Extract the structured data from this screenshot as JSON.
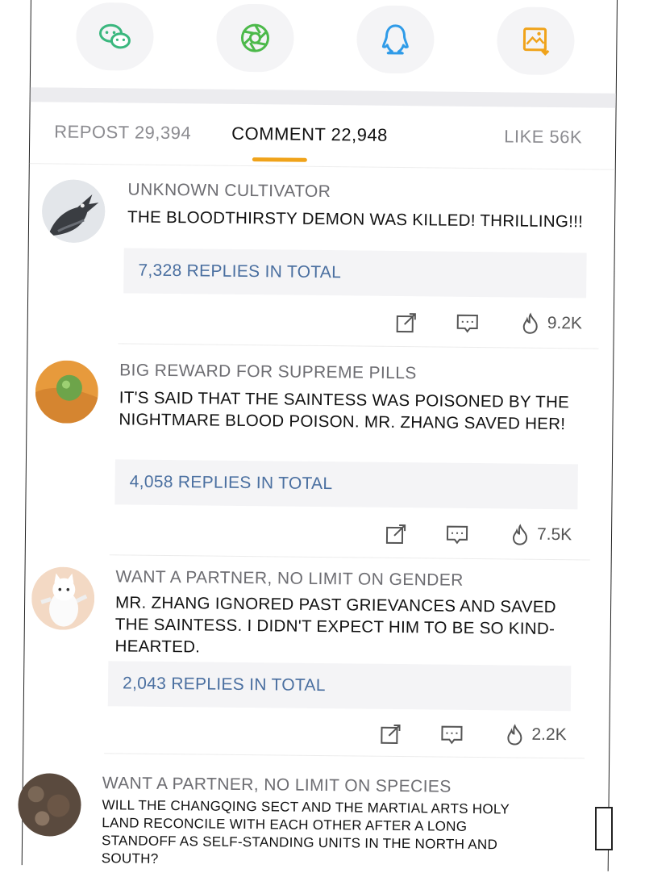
{
  "share": {
    "icons": [
      "wechat-icon",
      "moments-icon",
      "qq-icon",
      "save-image-icon"
    ],
    "colors": {
      "wechat": "#3ab77e",
      "moments": "#4cb94a",
      "qq": "#2f9be8",
      "save": "#f0a31a"
    }
  },
  "tabs": {
    "repost": "REPOST 29,394",
    "comment": "COMMENT 22,948",
    "like": "LIKE 56K",
    "active": "comment",
    "accent": "#f0a31a"
  },
  "comments": [
    {
      "username": "UNKNOWN CULTIVATOR",
      "text": "THE BLOODTHIRSTY DEMON WAS KILLED! THRILLING!!!",
      "replies": "7,328 REPLIES IN TOTAL",
      "likes": "9.2K"
    },
    {
      "username": "BIG REWARD FOR SUPREME PILLS",
      "text": "IT'S SAID THAT THE SAINTESS WAS POISONED BY THE NIGHTMARE BLOOD POISON. MR. ZHANG SAVED HER!",
      "replies": "4,058 REPLIES IN TOTAL",
      "likes": "7.5K"
    },
    {
      "username": "WANT A PARTNER, NO LIMIT ON GENDER",
      "text": "MR. ZHANG IGNORED PAST GRIEVANCES AND SAVED THE SAINTESS. I DIDN'T EXPECT HIM TO BE SO KIND-HEARTED.",
      "replies": "2,043 REPLIES IN TOTAL",
      "likes": "2.2K"
    },
    {
      "username": "WANT A PARTNER, NO LIMIT ON SPECIES",
      "text": "WILL THE CHANGQING SECT AND THE MARTIAL ARTS HOLY LAND RECONCILE WITH EACH OTHER AFTER A LONG STANDOFF AS SELF-STANDING UNITS IN THE NORTH AND SOUTH?"
    }
  ]
}
